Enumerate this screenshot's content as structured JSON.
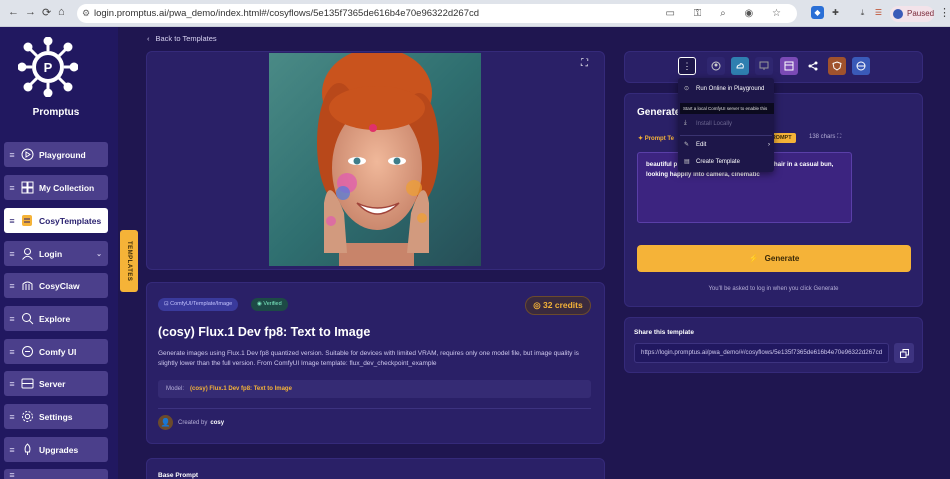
{
  "browser": {
    "url": "login.promptus.ai/pwa_demo/index.html#/cosyflows/5e135f7365de616b4e70e96322d267cd",
    "profile_status": "Paused"
  },
  "sidebar": {
    "brand": "Promptus",
    "items": [
      {
        "label": "Playground",
        "icon": "play-circle-icon"
      },
      {
        "label": "My Collection",
        "icon": "grid-icon"
      },
      {
        "label": "CosyTemplates",
        "icon": "document-icon"
      },
      {
        "label": "Login",
        "icon": "user-icon"
      },
      {
        "label": "CosyClaw",
        "icon": "claw-icon"
      },
      {
        "label": "Explore",
        "icon": "search-icon"
      },
      {
        "label": "Comfy UI",
        "icon": "link-icon"
      },
      {
        "label": "Server",
        "icon": "server-icon"
      },
      {
        "label": "Settings",
        "icon": "gear-icon"
      },
      {
        "label": "Upgrades",
        "icon": "rocket-icon"
      }
    ],
    "templates_tab": "TEMPLATES"
  },
  "main": {
    "back_label": "Back to Templates",
    "tags": [
      "ComfyUI/Template/Image",
      "Verified"
    ],
    "credits": "32 credits",
    "title": "(cosy) Flux.1 Dev fp8: Text to Image",
    "description": "Generate images using Flux.1 Dev fp8 quantized version. Suitable for devices with limited VRAM, requires only one model file, but image quality is slightly lower than the full version. From ComfyUI Image template: flux_dev_checkpoint_example",
    "model_label": "Model:",
    "model_value": "(cosy) Flux.1 Dev fp8: Text to Image",
    "created_by_label": "Created by",
    "creator": "cosy",
    "base_prompt_title": "Base Prompt"
  },
  "generate": {
    "title": "Generate",
    "prompt_label": "Prompt Te",
    "ai_prompt": "AI PROMPT",
    "chars": "138 chars",
    "prompt_text": "beautiful p                               artist, she is natural, having her hair in a casual bun, looking happily into camera, cinematic",
    "button": "Generate",
    "login_note": "You'll be asked to log in when you click Generate"
  },
  "share": {
    "title": "Share this template",
    "url": "https://login.promptus.ai/pwa_demo/#/cosyflows/5e135f7365de616b4e70e96322d267cd"
  },
  "menu": {
    "run_online": "Run Online in Playground",
    "tooltip": "Start a local ComfyUI server to enable this",
    "install_locally": "Install Locally",
    "edit": "Edit",
    "create_template": "Create Template"
  },
  "colors": {
    "background": "#1f1650",
    "panel": "#2a2067",
    "accent": "#f5b338",
    "sidebar": "#211860"
  }
}
